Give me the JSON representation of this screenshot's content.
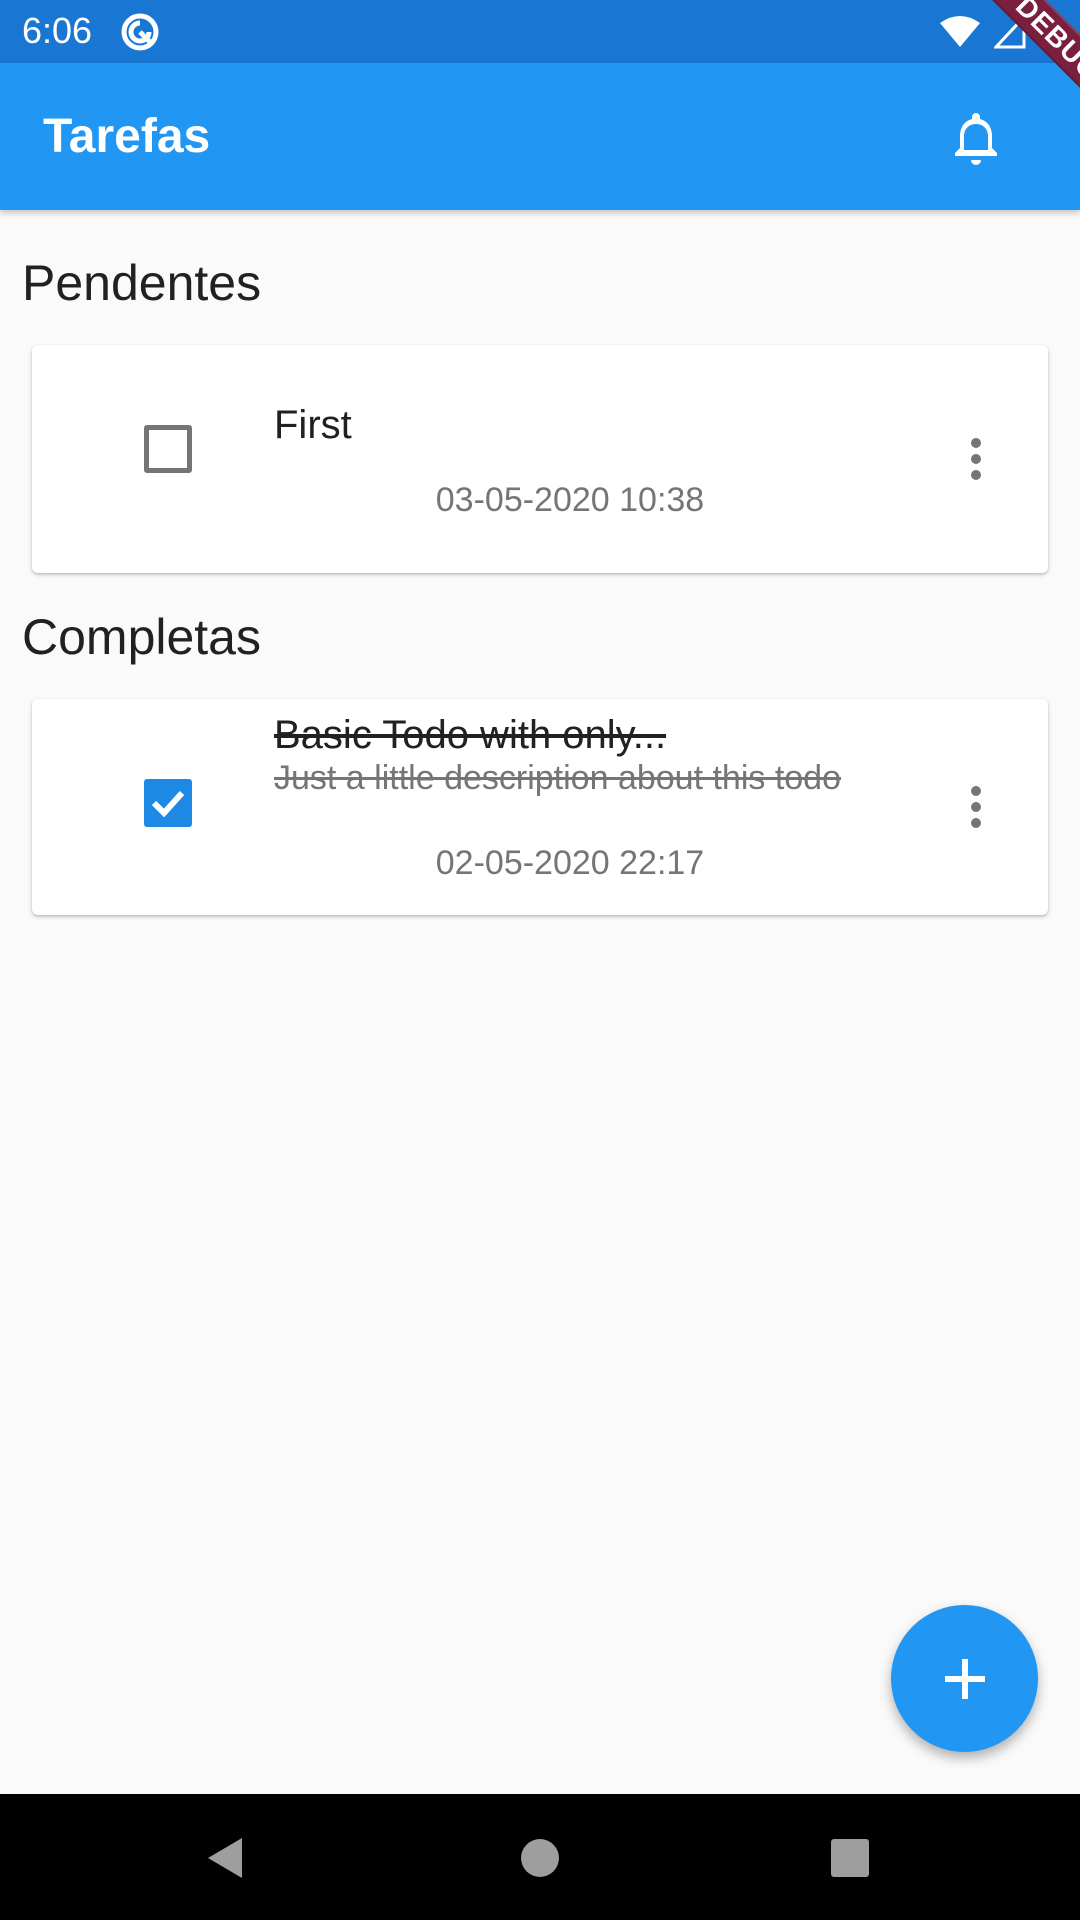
{
  "status_bar": {
    "time": "6:06"
  },
  "debug_banner": "DEBUG",
  "app_bar": {
    "title": "Tarefas"
  },
  "sections": {
    "pending": {
      "title": "Pendentes",
      "items": [
        {
          "title": "First",
          "description": "",
          "date": "03-05-2020 10:38",
          "completed": false
        }
      ]
    },
    "completed": {
      "title": "Completas",
      "items": [
        {
          "title": "Basic Todo with only...",
          "description": "Just a little description about this todo",
          "date": "02-05-2020 22:17",
          "completed": true
        }
      ]
    }
  },
  "colors": {
    "status_bar": "#1976d2",
    "app_bar": "#2196f3",
    "accent": "#2196f3",
    "checkbox_checked": "#1e88e5"
  },
  "icons": {
    "app_bar": "bell-icon",
    "fab": "plus-icon",
    "item_menu": "more-vertical-icon",
    "nav": [
      "back-triangle-icon",
      "home-circle-icon",
      "recents-square-icon"
    ]
  }
}
